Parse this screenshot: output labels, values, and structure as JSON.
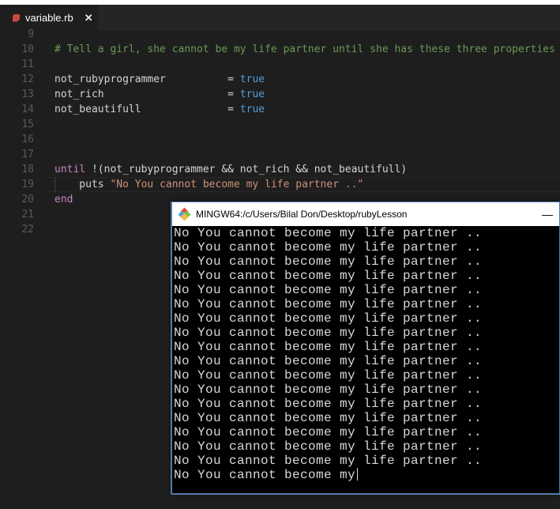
{
  "tab": {
    "filename": "variable.rb",
    "close": "✕"
  },
  "editor": {
    "lines": [
      {
        "num": "9",
        "tokens": []
      },
      {
        "num": "10",
        "tokens": [
          {
            "t": "# Tell a girl, she cannot be my life partner until she has these three properties",
            "c": "comment"
          }
        ]
      },
      {
        "num": "11",
        "tokens": []
      },
      {
        "num": "12",
        "tokens": [
          {
            "t": "not_rubyprogrammer          ",
            "c": "plain"
          },
          {
            "t": "= ",
            "c": "op"
          },
          {
            "t": "true",
            "c": "const"
          }
        ]
      },
      {
        "num": "13",
        "tokens": [
          {
            "t": "not_rich                    ",
            "c": "plain"
          },
          {
            "t": "= ",
            "c": "op"
          },
          {
            "t": "true",
            "c": "const"
          }
        ]
      },
      {
        "num": "14",
        "tokens": [
          {
            "t": "not_beautifull              ",
            "c": "plain"
          },
          {
            "t": "= ",
            "c": "op"
          },
          {
            "t": "true",
            "c": "const"
          }
        ]
      },
      {
        "num": "15",
        "tokens": []
      },
      {
        "num": "16",
        "tokens": []
      },
      {
        "num": "17",
        "tokens": []
      },
      {
        "num": "18",
        "tokens": [
          {
            "t": "until ",
            "c": "kw"
          },
          {
            "t": "!(not_rubyprogrammer && not_rich && not_beautifull)",
            "c": "plain"
          }
        ]
      },
      {
        "num": "19",
        "tokens": [
          {
            "t": "    puts ",
            "c": "plain"
          },
          {
            "t": "\"No You cannot become my life partner ..\"",
            "c": "str"
          }
        ]
      },
      {
        "num": "20",
        "tokens": [
          {
            "t": "end",
            "c": "kw"
          }
        ]
      },
      {
        "num": "21",
        "tokens": []
      },
      {
        "num": "22",
        "tokens": []
      }
    ]
  },
  "terminal": {
    "title": "MINGW64:/c/Users/Bilal Don/Desktop/rubyLesson",
    "minimize": "—",
    "lines": [
      "No You cannot become my life partner ..",
      "No You cannot become my life partner ..",
      "No You cannot become my life partner ..",
      "No You cannot become my life partner ..",
      "No You cannot become my life partner ..",
      "No You cannot become my life partner ..",
      "No You cannot become my life partner ..",
      "No You cannot become my life partner ..",
      "No You cannot become my life partner ..",
      "No You cannot become my life partner ..",
      "No You cannot become my life partner ..",
      "No You cannot become my life partner ..",
      "No You cannot become my life partner ..",
      "No You cannot become my life partner ..",
      "No You cannot become my life partner ..",
      "No You cannot become my life partner ..",
      "No You cannot become my life partner ..",
      "No You cannot become my"
    ]
  },
  "colors": {
    "comment": "#6a9955",
    "constant": "#569cd6",
    "keyword": "#c586c0",
    "string": "#ce9178",
    "ruby_icon": "#c84a3f",
    "git_icon": [
      "#e94e31",
      "#4aa3df",
      "#79c142",
      "#f5b83d"
    ]
  }
}
